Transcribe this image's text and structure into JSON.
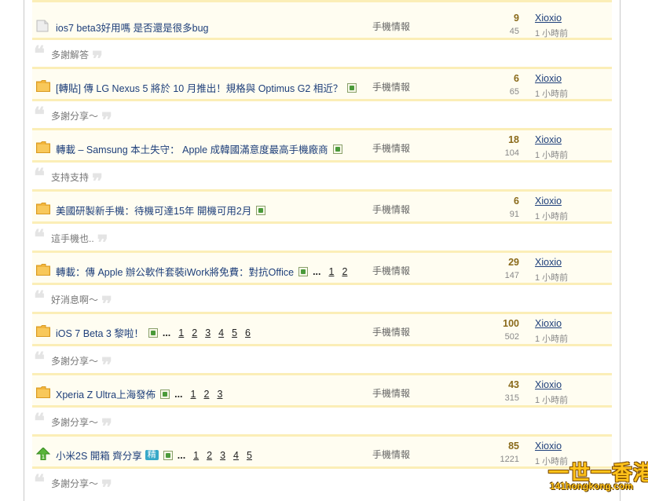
{
  "threads": [
    {
      "title": "ios7 beta3好用嗎 是否還是很多bug",
      "forum": "手機情報",
      "replies": "9",
      "views": "45",
      "user": "Xioxio",
      "time": "1 小時前",
      "icon": "folder-grey-icon",
      "image": false,
      "badge": "",
      "pages": [],
      "excerpt": "多謝解答"
    },
    {
      "title": "[轉貼] 傳 LG Nexus 5 將於 10 月推出！規格與 Optimus G2 相近？",
      "forum": "手機情報",
      "replies": "6",
      "views": "65",
      "user": "Xioxio",
      "time": "1 小時前",
      "icon": "folder-orange-icon",
      "image": true,
      "badge": "",
      "pages": [],
      "excerpt": "多謝分享～"
    },
    {
      "title": "轉載 – Samsung 本土失守： Apple 成韓國滿意度最高手機廠商",
      "forum": "手機情報",
      "replies": "18",
      "views": "104",
      "user": "Xioxio",
      "time": "1 小時前",
      "icon": "folder-orange-icon",
      "image": true,
      "badge": "",
      "pages": [],
      "excerpt": "支持支持"
    },
    {
      "title": "美國研製新手機：待機可達15年 開機可用2月",
      "forum": "手機情報",
      "replies": "6",
      "views": "91",
      "user": "Xioxio",
      "time": "1 小時前",
      "icon": "folder-orange-icon",
      "image": true,
      "badge": "",
      "pages": [],
      "excerpt": "這手機也.."
    },
    {
      "title": "轉載：傳 Apple 辦公軟件套裝iWork將免費：對抗Office",
      "forum": "手機情報",
      "replies": "29",
      "views": "147",
      "user": "Xioxio",
      "time": "1 小時前",
      "icon": "folder-orange-icon",
      "image": true,
      "badge": "",
      "pages": [
        "1",
        "2"
      ],
      "excerpt": "好消息啊～"
    },
    {
      "title": "iOS 7 Beta 3 黎啦！",
      "forum": "手機情報",
      "replies": "100",
      "views": "502",
      "user": "Xioxio",
      "time": "1 小時前",
      "icon": "folder-orange-icon",
      "image": true,
      "badge": "",
      "pages": [
        "1",
        "2",
        "3",
        "4",
        "5",
        "6"
      ],
      "excerpt": "多謝分享～"
    },
    {
      "title": "Xperia Z Ultra上海發佈",
      "forum": "手機情報",
      "replies": "43",
      "views": "315",
      "user": "Xioxio",
      "time": "1 小時前",
      "icon": "folder-orange-icon",
      "image": true,
      "badge": "",
      "pages": [
        "1",
        "2",
        "3"
      ],
      "excerpt": "多謝分享～"
    },
    {
      "title": "小米2S 開箱 齊分享",
      "forum": "手機情報",
      "replies": "85",
      "views": "1221",
      "user": "Xioxio",
      "time": "1 小時前",
      "icon": "upvote-green-icon",
      "image": true,
      "badge": "精",
      "pages": [
        "1",
        "2",
        "3",
        "4",
        "5"
      ],
      "excerpt": "多謝分享～"
    }
  ],
  "ellipsis": "...",
  "quote_open": "❝",
  "quote_close": "❞",
  "watermark": {
    "main": "一世一香港",
    "sub": "141hongkong.com"
  },
  "colors": {
    "row_bg": "#fffdf1",
    "row_border": "#fbeeb7",
    "link": "#1e3f7a",
    "reply_count": "#8a6a1a",
    "badge": "#36a8c8"
  }
}
